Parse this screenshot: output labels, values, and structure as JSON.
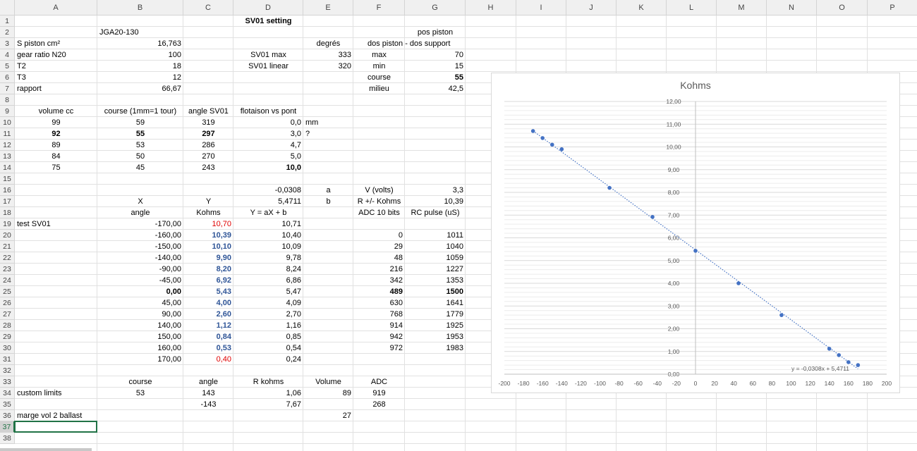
{
  "columns": [
    "A",
    "B",
    "C",
    "D",
    "E",
    "F",
    "G",
    "H",
    "I",
    "J",
    "K",
    "L",
    "M",
    "N",
    "O",
    "P"
  ],
  "rows": [
    "1",
    "2",
    "3",
    "4",
    "5",
    "6",
    "7",
    "8",
    "9",
    "10",
    "11",
    "12",
    "13",
    "14",
    "15",
    "16",
    "17",
    "18",
    "19",
    "20",
    "21",
    "22",
    "23",
    "24",
    "25",
    "26",
    "27",
    "28",
    "29",
    "30",
    "31",
    "32",
    "33",
    "34",
    "35",
    "36",
    "37",
    "38"
  ],
  "selected_row": "37",
  "cells": [
    {
      "r": 1,
      "c": "D",
      "v": "SV01 setting",
      "s": "bold al-c"
    },
    {
      "r": 2,
      "c": "B",
      "v": "JGA20-130",
      "s": "al-l"
    },
    {
      "r": 2,
      "c": "G",
      "v": "pos piston",
      "s": "al-c"
    },
    {
      "r": 3,
      "c": "A",
      "v": "S piston cm²",
      "s": "al-l"
    },
    {
      "r": 3,
      "c": "B",
      "v": "16,763",
      "s": "al-r"
    },
    {
      "r": 3,
      "c": "E",
      "v": "degrés",
      "s": "al-c"
    },
    {
      "r": 3,
      "c": "F",
      "v": "dos piston - dos support",
      "s": "al-l fwide"
    },
    {
      "r": 4,
      "c": "A",
      "v": "gear ratio N20",
      "s": "al-l"
    },
    {
      "r": 4,
      "c": "B",
      "v": "100",
      "s": "al-r"
    },
    {
      "r": 4,
      "c": "D",
      "v": "SV01 max",
      "s": "al-c"
    },
    {
      "r": 4,
      "c": "E",
      "v": "333",
      "s": "al-r"
    },
    {
      "r": 4,
      "c": "F",
      "v": "max",
      "s": "al-c"
    },
    {
      "r": 4,
      "c": "G",
      "v": "70",
      "s": "al-r"
    },
    {
      "r": 5,
      "c": "A",
      "v": "T2",
      "s": "al-l"
    },
    {
      "r": 5,
      "c": "B",
      "v": "18",
      "s": "al-r"
    },
    {
      "r": 5,
      "c": "D",
      "v": "SV01 linear",
      "s": "al-c"
    },
    {
      "r": 5,
      "c": "E",
      "v": "320",
      "s": "al-r"
    },
    {
      "r": 5,
      "c": "F",
      "v": "min",
      "s": "al-c"
    },
    {
      "r": 5,
      "c": "G",
      "v": "15",
      "s": "al-r"
    },
    {
      "r": 6,
      "c": "A",
      "v": "T3",
      "s": "al-l"
    },
    {
      "r": 6,
      "c": "B",
      "v": "12",
      "s": "al-r"
    },
    {
      "r": 6,
      "c": "F",
      "v": "course",
      "s": "al-c"
    },
    {
      "r": 6,
      "c": "G",
      "v": "55",
      "s": "al-r bold"
    },
    {
      "r": 7,
      "c": "A",
      "v": "rapport",
      "s": "al-l"
    },
    {
      "r": 7,
      "c": "B",
      "v": "66,67",
      "s": "al-r"
    },
    {
      "r": 7,
      "c": "F",
      "v": "milieu",
      "s": "al-c"
    },
    {
      "r": 7,
      "c": "G",
      "v": "42,5",
      "s": "al-r"
    },
    {
      "r": 9,
      "c": "A",
      "v": "volume cc",
      "s": "al-c"
    },
    {
      "r": 9,
      "c": "B",
      "v": "course (1mm=1 tour)",
      "s": "al-c"
    },
    {
      "r": 9,
      "c": "C",
      "v": "angle SV01",
      "s": "al-c"
    },
    {
      "r": 9,
      "c": "D",
      "v": "flotaison vs pont",
      "s": "al-c"
    },
    {
      "r": 10,
      "c": "A",
      "v": "99",
      "s": "al-c"
    },
    {
      "r": 10,
      "c": "B",
      "v": "59",
      "s": "al-c"
    },
    {
      "r": 10,
      "c": "C",
      "v": "319",
      "s": "al-c"
    },
    {
      "r": 10,
      "c": "D",
      "v": "0,0",
      "s": "al-r"
    },
    {
      "r": 10,
      "c": "E",
      "v": "mm",
      "s": "al-l"
    },
    {
      "r": 11,
      "c": "A",
      "v": "92",
      "s": "al-c bold"
    },
    {
      "r": 11,
      "c": "B",
      "v": "55",
      "s": "al-c bold"
    },
    {
      "r": 11,
      "c": "C",
      "v": "297",
      "s": "al-c bold"
    },
    {
      "r": 11,
      "c": "D",
      "v": "3,0",
      "s": "al-r"
    },
    {
      "r": 11,
      "c": "E",
      "v": "?",
      "s": "al-l"
    },
    {
      "r": 12,
      "c": "A",
      "v": "89",
      "s": "al-c"
    },
    {
      "r": 12,
      "c": "B",
      "v": "53",
      "s": "al-c"
    },
    {
      "r": 12,
      "c": "C",
      "v": "286",
      "s": "al-c"
    },
    {
      "r": 12,
      "c": "D",
      "v": "4,7",
      "s": "al-r"
    },
    {
      "r": 13,
      "c": "A",
      "v": "84",
      "s": "al-c"
    },
    {
      "r": 13,
      "c": "B",
      "v": "50",
      "s": "al-c"
    },
    {
      "r": 13,
      "c": "C",
      "v": "270",
      "s": "al-c"
    },
    {
      "r": 13,
      "c": "D",
      "v": "5,0",
      "s": "al-r"
    },
    {
      "r": 14,
      "c": "A",
      "v": "75",
      "s": "al-c"
    },
    {
      "r": 14,
      "c": "B",
      "v": "45",
      "s": "al-c"
    },
    {
      "r": 14,
      "c": "C",
      "v": "243",
      "s": "al-c"
    },
    {
      "r": 14,
      "c": "D",
      "v": "10,0",
      "s": "al-r bold"
    },
    {
      "r": 16,
      "c": "D",
      "v": "-0,0308",
      "s": "al-r"
    },
    {
      "r": 16,
      "c": "E",
      "v": "a",
      "s": "al-c"
    },
    {
      "r": 16,
      "c": "F",
      "v": "V (volts)",
      "s": "al-c"
    },
    {
      "r": 16,
      "c": "G",
      "v": "3,3",
      "s": "al-r"
    },
    {
      "r": 17,
      "c": "B",
      "v": "X",
      "s": "al-c"
    },
    {
      "r": 17,
      "c": "C",
      "v": "Y",
      "s": "al-c"
    },
    {
      "r": 17,
      "c": "D",
      "v": "5,4711",
      "s": "al-r"
    },
    {
      "r": 17,
      "c": "E",
      "v": "b",
      "s": "al-c"
    },
    {
      "r": 17,
      "c": "F",
      "v": "R +/- Kohms",
      "s": "al-c"
    },
    {
      "r": 17,
      "c": "G",
      "v": "10,39",
      "s": "al-r"
    },
    {
      "r": 18,
      "c": "B",
      "v": "angle",
      "s": "al-c"
    },
    {
      "r": 18,
      "c": "C",
      "v": "Kohms",
      "s": "al-c"
    },
    {
      "r": 18,
      "c": "D",
      "v": "Y = aX + b",
      "s": "al-c"
    },
    {
      "r": 18,
      "c": "F",
      "v": "ADC 10 bits",
      "s": "al-c"
    },
    {
      "r": 18,
      "c": "G",
      "v": "RC pulse (uS)",
      "s": "al-c"
    },
    {
      "r": 19,
      "c": "A",
      "v": "test SV01",
      "s": "al-l"
    },
    {
      "r": 19,
      "c": "B",
      "v": "-170,00",
      "s": "al-r"
    },
    {
      "r": 19,
      "c": "C",
      "v": "10,70",
      "s": "al-r red"
    },
    {
      "r": 19,
      "c": "D",
      "v": "10,71",
      "s": "al-r"
    },
    {
      "r": 20,
      "c": "B",
      "v": "-160,00",
      "s": "al-r"
    },
    {
      "r": 20,
      "c": "C",
      "v": "10,39",
      "s": "al-r blue"
    },
    {
      "r": 20,
      "c": "D",
      "v": "10,40",
      "s": "al-r"
    },
    {
      "r": 20,
      "c": "F",
      "v": "0",
      "s": "al-r"
    },
    {
      "r": 20,
      "c": "G",
      "v": "1011",
      "s": "al-r"
    },
    {
      "r": 21,
      "c": "B",
      "v": "-150,00",
      "s": "al-r"
    },
    {
      "r": 21,
      "c": "C",
      "v": "10,10",
      "s": "al-r blue"
    },
    {
      "r": 21,
      "c": "D",
      "v": "10,09",
      "s": "al-r"
    },
    {
      "r": 21,
      "c": "F",
      "v": "29",
      "s": "al-r"
    },
    {
      "r": 21,
      "c": "G",
      "v": "1040",
      "s": "al-r"
    },
    {
      "r": 22,
      "c": "B",
      "v": "-140,00",
      "s": "al-r"
    },
    {
      "r": 22,
      "c": "C",
      "v": "9,90",
      "s": "al-r blue"
    },
    {
      "r": 22,
      "c": "D",
      "v": "9,78",
      "s": "al-r"
    },
    {
      "r": 22,
      "c": "F",
      "v": "48",
      "s": "al-r"
    },
    {
      "r": 22,
      "c": "G",
      "v": "1059",
      "s": "al-r"
    },
    {
      "r": 23,
      "c": "B",
      "v": "-90,00",
      "s": "al-r"
    },
    {
      "r": 23,
      "c": "C",
      "v": "8,20",
      "s": "al-r blue"
    },
    {
      "r": 23,
      "c": "D",
      "v": "8,24",
      "s": "al-r"
    },
    {
      "r": 23,
      "c": "F",
      "v": "216",
      "s": "al-r"
    },
    {
      "r": 23,
      "c": "G",
      "v": "1227",
      "s": "al-r"
    },
    {
      "r": 24,
      "c": "B",
      "v": "-45,00",
      "s": "al-r"
    },
    {
      "r": 24,
      "c": "C",
      "v": "6,92",
      "s": "al-r blue"
    },
    {
      "r": 24,
      "c": "D",
      "v": "6,86",
      "s": "al-r"
    },
    {
      "r": 24,
      "c": "F",
      "v": "342",
      "s": "al-r"
    },
    {
      "r": 24,
      "c": "G",
      "v": "1353",
      "s": "al-r"
    },
    {
      "r": 25,
      "c": "B",
      "v": "0,00",
      "s": "al-r bold"
    },
    {
      "r": 25,
      "c": "C",
      "v": "5,43",
      "s": "al-r blue"
    },
    {
      "r": 25,
      "c": "D",
      "v": "5,47",
      "s": "al-r"
    },
    {
      "r": 25,
      "c": "F",
      "v": "489",
      "s": "al-r bold"
    },
    {
      "r": 25,
      "c": "G",
      "v": "1500",
      "s": "al-r bold"
    },
    {
      "r": 26,
      "c": "B",
      "v": "45,00",
      "s": "al-r"
    },
    {
      "r": 26,
      "c": "C",
      "v": "4,00",
      "s": "al-r blue"
    },
    {
      "r": 26,
      "c": "D",
      "v": "4,09",
      "s": "al-r"
    },
    {
      "r": 26,
      "c": "F",
      "v": "630",
      "s": "al-r"
    },
    {
      "r": 26,
      "c": "G",
      "v": "1641",
      "s": "al-r"
    },
    {
      "r": 27,
      "c": "B",
      "v": "90,00",
      "s": "al-r"
    },
    {
      "r": 27,
      "c": "C",
      "v": "2,60",
      "s": "al-r blue"
    },
    {
      "r": 27,
      "c": "D",
      "v": "2,70",
      "s": "al-r"
    },
    {
      "r": 27,
      "c": "F",
      "v": "768",
      "s": "al-r"
    },
    {
      "r": 27,
      "c": "G",
      "v": "1779",
      "s": "al-r"
    },
    {
      "r": 28,
      "c": "B",
      "v": "140,00",
      "s": "al-r"
    },
    {
      "r": 28,
      "c": "C",
      "v": "1,12",
      "s": "al-r blue"
    },
    {
      "r": 28,
      "c": "D",
      "v": "1,16",
      "s": "al-r"
    },
    {
      "r": 28,
      "c": "F",
      "v": "914",
      "s": "al-r"
    },
    {
      "r": 28,
      "c": "G",
      "v": "1925",
      "s": "al-r"
    },
    {
      "r": 29,
      "c": "B",
      "v": "150,00",
      "s": "al-r"
    },
    {
      "r": 29,
      "c": "C",
      "v": "0,84",
      "s": "al-r blue"
    },
    {
      "r": 29,
      "c": "D",
      "v": "0,85",
      "s": "al-r"
    },
    {
      "r": 29,
      "c": "F",
      "v": "942",
      "s": "al-r"
    },
    {
      "r": 29,
      "c": "G",
      "v": "1953",
      "s": "al-r"
    },
    {
      "r": 30,
      "c": "B",
      "v": "160,00",
      "s": "al-r"
    },
    {
      "r": 30,
      "c": "C",
      "v": "0,53",
      "s": "al-r blue"
    },
    {
      "r": 30,
      "c": "D",
      "v": "0,54",
      "s": "al-r"
    },
    {
      "r": 30,
      "c": "F",
      "v": "972",
      "s": "al-r"
    },
    {
      "r": 30,
      "c": "G",
      "v": "1983",
      "s": "al-r"
    },
    {
      "r": 31,
      "c": "B",
      "v": "170,00",
      "s": "al-r"
    },
    {
      "r": 31,
      "c": "C",
      "v": "0,40",
      "s": "al-r red"
    },
    {
      "r": 31,
      "c": "D",
      "v": "0,24",
      "s": "al-r"
    },
    {
      "r": 33,
      "c": "B",
      "v": "course",
      "s": "al-c"
    },
    {
      "r": 33,
      "c": "C",
      "v": "angle",
      "s": "al-c"
    },
    {
      "r": 33,
      "c": "D",
      "v": "R kohms",
      "s": "al-c"
    },
    {
      "r": 33,
      "c": "E",
      "v": "Volume",
      "s": "al-c"
    },
    {
      "r": 33,
      "c": "F",
      "v": "ADC",
      "s": "al-c"
    },
    {
      "r": 34,
      "c": "A",
      "v": "custom limits",
      "s": "al-l"
    },
    {
      "r": 34,
      "c": "B",
      "v": "53",
      "s": "al-c"
    },
    {
      "r": 34,
      "c": "C",
      "v": "143",
      "s": "al-c"
    },
    {
      "r": 34,
      "c": "D",
      "v": "1,06",
      "s": "al-r"
    },
    {
      "r": 34,
      "c": "E",
      "v": "89",
      "s": "al-r"
    },
    {
      "r": 34,
      "c": "F",
      "v": "919",
      "s": "al-c"
    },
    {
      "r": 35,
      "c": "C",
      "v": "-143",
      "s": "al-c"
    },
    {
      "r": 35,
      "c": "D",
      "v": "7,67",
      "s": "al-r"
    },
    {
      "r": 35,
      "c": "F",
      "v": "268",
      "s": "al-c"
    },
    {
      "r": 36,
      "c": "A",
      "v": "marge vol 2 ballast",
      "s": "al-l"
    },
    {
      "r": 36,
      "c": "E",
      "v": "27",
      "s": "al-r"
    }
  ],
  "chart_data": {
    "type": "scatter",
    "title": "Kohms",
    "xlim": [
      -200,
      200
    ],
    "ylim": [
      0,
      12
    ],
    "xticks": [
      "-200",
      "-180",
      "-160",
      "-140",
      "-120",
      "-100",
      "-80",
      "-60",
      "-40",
      "-20",
      "0",
      "20",
      "40",
      "60",
      "80",
      "100",
      "120",
      "140",
      "160",
      "180",
      "200"
    ],
    "yticks": [
      "0,00",
      "1,00",
      "2,00",
      "3,00",
      "4,00",
      "5,00",
      "6,00",
      "7,00",
      "8,00",
      "9,00",
      "10,00",
      "11,00",
      "12,00"
    ],
    "x": [
      -170,
      -160,
      -150,
      -140,
      -90,
      -45,
      0,
      45,
      90,
      140,
      150,
      160,
      170
    ],
    "y": [
      10.7,
      10.39,
      10.1,
      9.9,
      8.2,
      6.92,
      5.43,
      4.0,
      2.6,
      1.12,
      0.84,
      0.53,
      0.4
    ],
    "trendline": {
      "slope": -0.0308,
      "intercept": 5.4711,
      "label": "y = -0,0308x + 5,4711"
    },
    "grid": true,
    "colors": {
      "marker": "#4472c4",
      "trend": "#4472c4",
      "grid": "#d9d9d9",
      "text": "#595959"
    }
  }
}
